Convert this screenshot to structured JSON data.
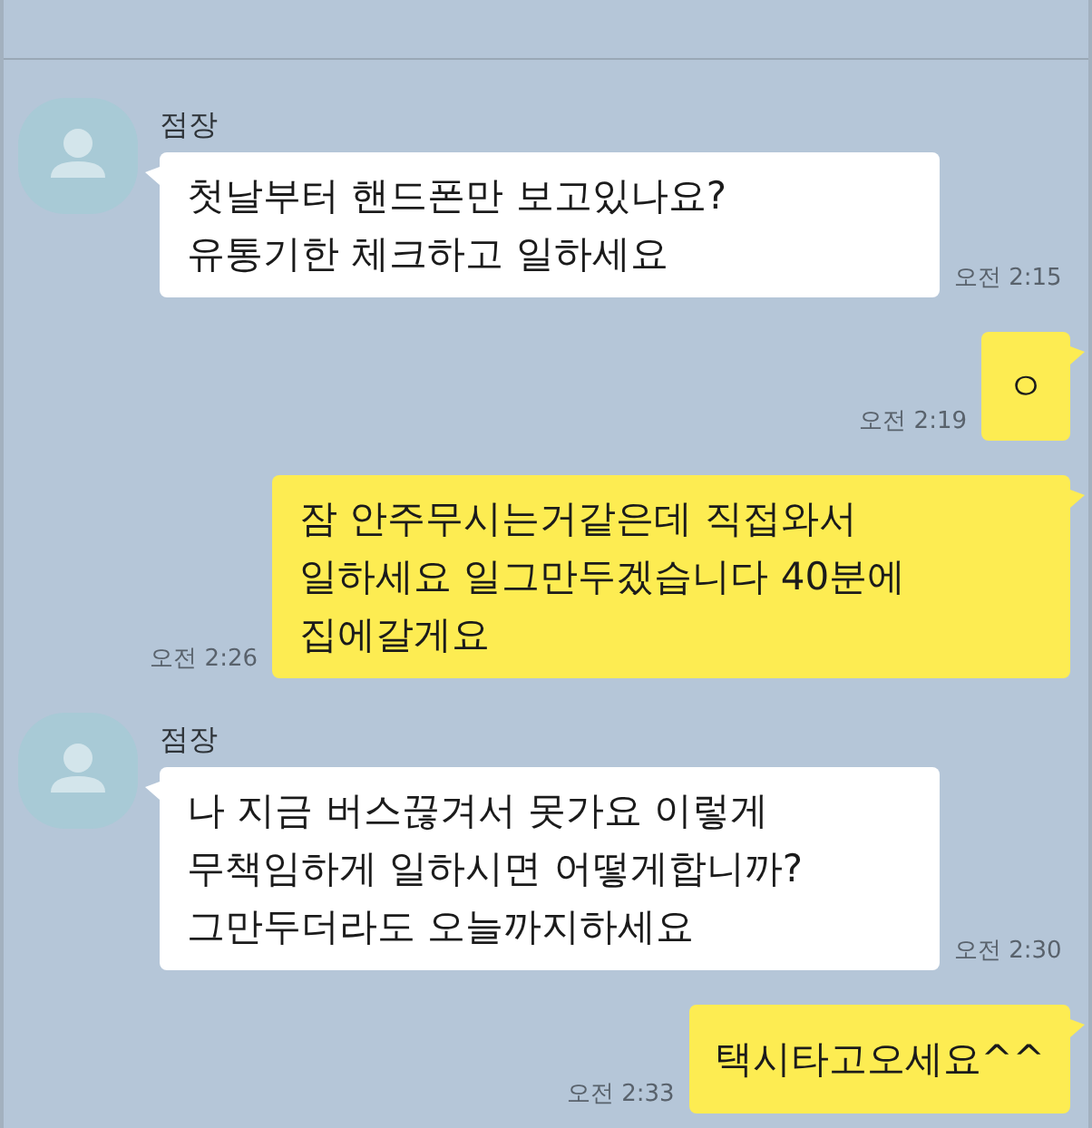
{
  "messages": [
    {
      "kind": "received",
      "sender": "점장",
      "lines": [
        "첫날부터 핸드폰만 보고있나요?",
        "유통기한 체크하고 일하세요"
      ],
      "time": "오전 2:15"
    },
    {
      "kind": "sent",
      "lines": [
        "ㅇ"
      ],
      "time": "오전 2:19"
    },
    {
      "kind": "sent",
      "lines": [
        "잠 안주무시는거같은데 직접와서",
        "일하세요 일그만두겠습니다 40분에",
        "집에갈게요"
      ],
      "time": "오전 2:26"
    },
    {
      "kind": "received",
      "sender": "점장",
      "lines": [
        "나 지금 버스끊겨서 못가요 이렇게",
        "무책임하게 일하시면 어떻게합니까?",
        "그만두더라도 오늘까지하세요"
      ],
      "time": "오전 2:30"
    },
    {
      "kind": "sent",
      "lines": [
        "택시타고오세요^^"
      ],
      "time": "오전 2:33"
    }
  ]
}
